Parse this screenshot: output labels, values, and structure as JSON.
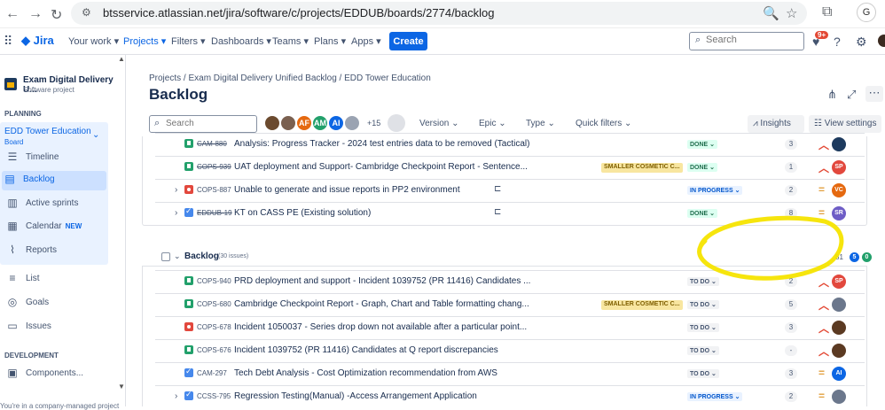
{
  "browser": {
    "url": "btsservice.atlassian.net/jira/software/c/projects/EDDUB/boards/2774/backlog",
    "profile_initial": "G"
  },
  "topnav": {
    "logo": "Jira",
    "items": [
      "Your work",
      "Projects",
      "Filters",
      "Dashboards",
      "Teams",
      "Plans",
      "Apps"
    ],
    "create_label": "Create",
    "search_placeholder": "Search",
    "notif_badge": "9+"
  },
  "sidebar": {
    "project_name": "Exam Digital Delivery U...",
    "project_type": "Software project",
    "planning_label": "PLANNING",
    "board_name": "EDD Tower Education",
    "board_sub": "Board",
    "items": [
      {
        "label": "Timeline",
        "icon": "timeline-icon"
      },
      {
        "label": "Backlog",
        "icon": "backlog-icon"
      },
      {
        "label": "Active sprints",
        "icon": "sprints-icon"
      },
      {
        "label": "Calendar",
        "icon": "calendar-icon",
        "tag": "NEW"
      },
      {
        "label": "Reports",
        "icon": "reports-icon"
      }
    ],
    "other_items": [
      {
        "label": "List",
        "icon": "list-icon"
      },
      {
        "label": "Goals",
        "icon": "goals-icon"
      },
      {
        "label": "Issues",
        "icon": "issues-icon"
      }
    ],
    "development_label": "DEVELOPMENT",
    "dev_items": [
      {
        "label": "Components...",
        "icon": "components-icon"
      }
    ],
    "footer": "You're in a company-managed project"
  },
  "main": {
    "breadcrumb": [
      "Projects",
      "Exam Digital Delivery Unified Backlog",
      "EDD Tower Education"
    ],
    "title": "Backlog",
    "search_placeholder": "Search",
    "avatars": [
      {
        "initials": "",
        "color": "#6b4a2e"
      },
      {
        "initials": "",
        "color": "#7a6050"
      },
      {
        "initials": "AF",
        "color": "#e56910"
      },
      {
        "initials": "AM",
        "color": "#22a06b"
      },
      {
        "initials": "AI",
        "color": "#0c66e4"
      },
      {
        "initials": "",
        "color": "#9aa3b2"
      }
    ],
    "avatar_more": "+15",
    "filters": [
      "Version",
      "Epic",
      "Type",
      "Quick filters"
    ],
    "insights_label": "Insights",
    "view_settings_label": "View settings"
  },
  "sprint_rows": [
    {
      "key": "CAM-880",
      "done": true,
      "type": "story",
      "summary": "Analysis: Progress Tracker - 2024 test entries data to be removed (Tactical)",
      "status": "DONE",
      "status_class": "done",
      "est": "3",
      "prio": "high",
      "assignee": "",
      "as_color": "#1d3a5e",
      "child": false,
      "epic": "",
      "expand": false
    },
    {
      "key": "COPS-939",
      "done": true,
      "type": "story",
      "summary": "UAT deployment and Support- Cambridge Checkpoint Report - Sentence...",
      "status": "DONE",
      "status_class": "done",
      "est": "1",
      "prio": "high",
      "assignee": "SP",
      "as_color": "#e2483d",
      "child": false,
      "epic": "SMALLER COSMETIC C...",
      "expand": false
    },
    {
      "key": "COPS-887",
      "done": false,
      "type": "bug",
      "summary": "Unable to generate and issue reports in PP2 environment",
      "status": "IN PROGRESS",
      "status_class": "prog",
      "est": "2",
      "prio": "med",
      "assignee": "VC",
      "as_color": "#e56910",
      "child": true,
      "epic": "",
      "expand": true
    },
    {
      "key": "EDDUB-19",
      "done": true,
      "type": "task",
      "summary": "KT on CASS PE (Existing solution)",
      "status": "DONE",
      "status_class": "done",
      "est": "8",
      "prio": "med",
      "assignee": "SR",
      "as_color": "#6e5dc6",
      "child": true,
      "epic": "",
      "expand": true
    }
  ],
  "backlog": {
    "title": "Backlog",
    "count": "(30 issues)",
    "total": "81",
    "pills": [
      {
        "value": "5",
        "color": "#0c66e4"
      },
      {
        "value": "0",
        "color": "#22a06b"
      }
    ]
  },
  "backlog_rows": [
    {
      "key": "COPS-940",
      "type": "story",
      "summary": "PRD deployment and support - Incident 1039752 (PR 11416) Candidates ...",
      "status": "TO DO",
      "status_class": "todo",
      "est": "2",
      "prio": "high",
      "assignee": "SP",
      "as_color": "#e2483d",
      "epic": "",
      "expand": false
    },
    {
      "key": "COPS-680",
      "type": "story",
      "summary": "Cambridge Checkpoint Report - Graph, Chart and Table formatting chang...",
      "status": "TO DO",
      "status_class": "todo",
      "est": "5",
      "prio": "high",
      "assignee": "",
      "as_color": "#6b778c",
      "epic": "SMALLER COSMETIC C...",
      "expand": false
    },
    {
      "key": "COPS-678",
      "type": "bug",
      "summary": "Incident 1050037 - Series drop down not available after a particular point...",
      "status": "TO DO",
      "status_class": "todo",
      "est": "3",
      "prio": "high",
      "assignee": "",
      "as_color": "#5b3a22",
      "epic": "",
      "expand": false
    },
    {
      "key": "COPS-676",
      "type": "story",
      "summary": "Incident 1039752 (PR 11416) Candidates at Q report discrepancies",
      "status": "TO DO",
      "status_class": "todo",
      "est": "-",
      "prio": "high",
      "assignee": "",
      "as_color": "#5b3a22",
      "epic": "",
      "expand": false
    },
    {
      "key": "CAM-297",
      "type": "task",
      "summary": "Tech Debt Analysis - Cost Optimization recommendation from AWS",
      "status": "TO DO",
      "status_class": "todo",
      "est": "3",
      "prio": "med",
      "assignee": "AI",
      "as_color": "#0c66e4",
      "epic": "",
      "expand": false
    },
    {
      "key": "CCSS-795",
      "type": "task",
      "summary": "Regression Testing(Manual) -Access Arrangement Application",
      "status": "IN PROGRESS",
      "status_class": "prog",
      "est": "2",
      "prio": "med",
      "assignee": "",
      "as_color": "#6b778c",
      "epic": "",
      "expand": true
    }
  ],
  "colors": {
    "accent": "#0c66e4",
    "annotation": "#f5e400"
  }
}
